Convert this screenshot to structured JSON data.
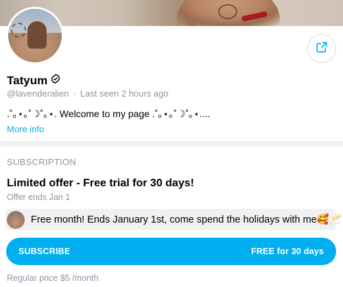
{
  "profile": {
    "name": "Tatyum",
    "handle": "@lavenderalien",
    "separator": "·",
    "last_seen": "Last seen 2 hours ago",
    "bio": ".˚｡⋆｡˚☽˚｡⋆. Welcome to my page .˚｡⋆｡˚☽˚｡⋆....",
    "more_info": "More info"
  },
  "subscription": {
    "heading": "SUBSCRIPTION",
    "offer_title": "Limited offer - Free trial for 30 days!",
    "offer_ends": "Offer ends Jan 1",
    "promo_message": "Free month! Ends January 1st, come spend the holidays with me🥰🥂",
    "subscribe_label": "SUBSCRIBE",
    "subscribe_price": "FREE for 30 days",
    "regular_price": "Regular price $5 /month"
  },
  "icons": {
    "verified": "verified-badge-icon",
    "share": "share-icon"
  },
  "colors": {
    "accent": "#00aff0",
    "muted_text": "#8a96a3",
    "divider": "#f0f1f3"
  }
}
